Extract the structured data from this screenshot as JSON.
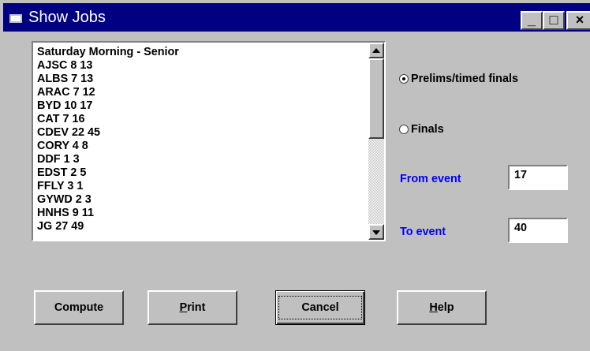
{
  "window": {
    "title": "Show Jobs"
  },
  "titlebar_buttons": {
    "minimize": "_",
    "maximize": "□",
    "close": "×"
  },
  "job_list": {
    "items": [
      "Saturday Morning - Senior",
      "AJSC 8 13",
      "ALBS 7 13",
      "ARAC 7 12",
      "BYD 10 17",
      "CAT 7 16",
      "CDEV 22 45",
      "CORY 4 8",
      "DDF 1 3",
      "EDST 2 5",
      "FFLY 3 1",
      "GYWD 2 3",
      "HNHS 9 11",
      "JG 27 49"
    ]
  },
  "options": {
    "prelims_label": "Prelims/timed finals",
    "prelims_selected": true,
    "finals_label": "Finals",
    "finals_selected": false
  },
  "from_event": {
    "label": "From event",
    "value": "17"
  },
  "to_event": {
    "label": "To event",
    "value": "40"
  },
  "buttons": {
    "compute": "Compute",
    "print_mnemonic": "P",
    "print_rest": "rint",
    "cancel": "Cancel",
    "help_mnemonic": "H",
    "help_rest": "elp"
  },
  "colors": {
    "titlebar": "#000080",
    "label_blue": "#0000ff",
    "face": "#c0c0c0"
  }
}
